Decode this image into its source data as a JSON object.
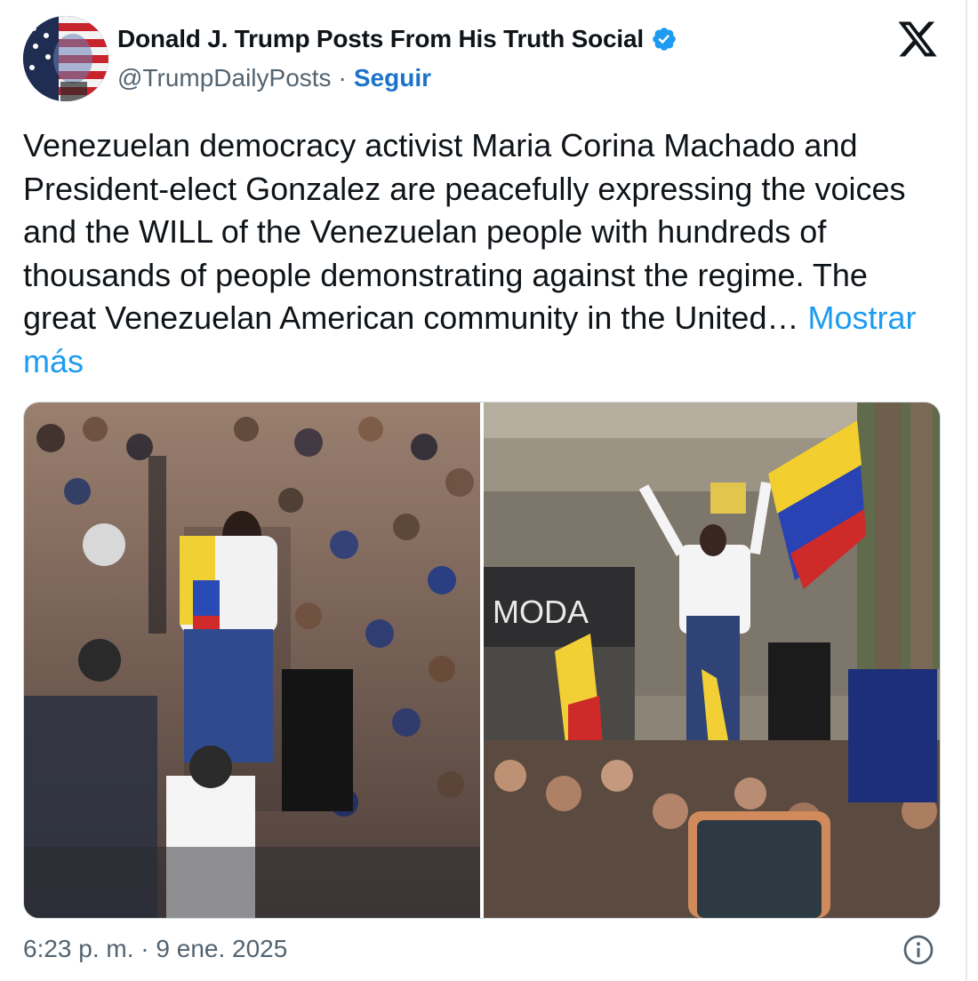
{
  "author": {
    "name": "Donald J. Trump Posts From His Truth Social",
    "handle": "@TrumpDailyPosts",
    "separator": "·",
    "follow_label": "Seguir",
    "avatar_icon": "stars-and-stripes-portrait-avatar"
  },
  "tweet": {
    "text": "Venezuelan democracy activist Maria Corina Machado and President-elect Gonzalez are peacefully expressing the voices and the WILL of the Venezuelan people with hundreds of thousands of people demonstrating against the regime. The great Venezuelan American community in the United…",
    "show_more_label": "Mostrar más"
  },
  "media": {
    "photos": [
      {
        "name": "rally-photo-crowd"
      },
      {
        "name": "rally-photo-flag",
        "sign_text": "MODA"
      }
    ]
  },
  "footer": {
    "timestamp": "6:23 p. m. · 9 ene. 2025"
  },
  "colors": {
    "link": "#1d9bf0",
    "follow": "#1d72c9",
    "verified": "#1d9bf0",
    "muted": "#536471"
  }
}
